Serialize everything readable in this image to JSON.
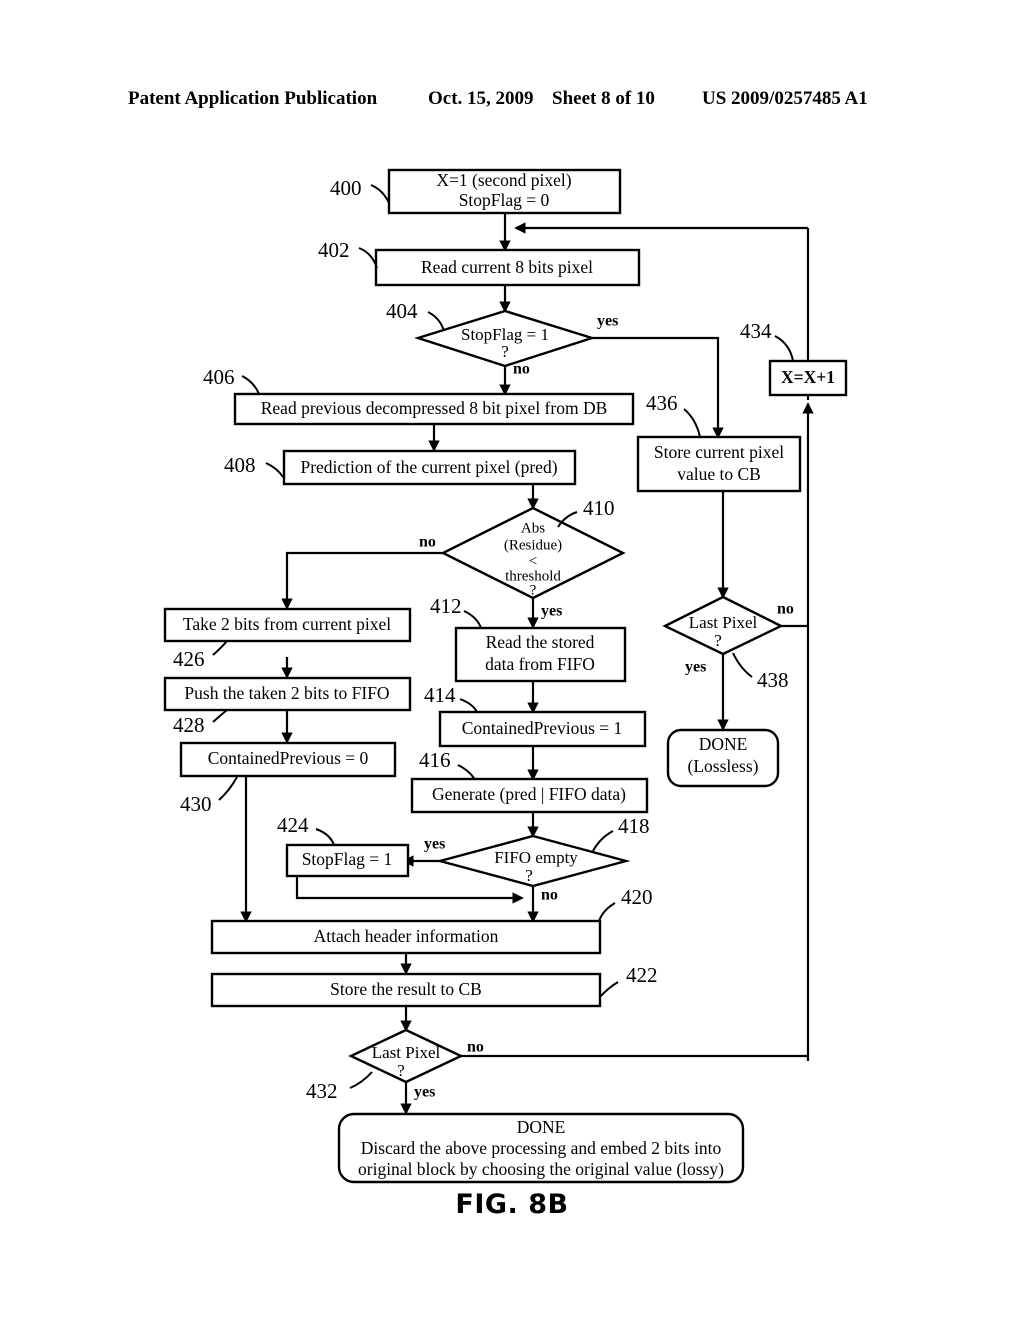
{
  "header": {
    "publication": "Patent Application Publication",
    "date": "Oct. 15, 2009",
    "sheet": "Sheet 8 of 10",
    "patent_number": "US 2009/0257485 A1"
  },
  "figure": {
    "label": "FIG. 8B",
    "caption": "FIG. 8B"
  },
  "nodes": {
    "n400": {
      "ref": "400",
      "line1": "X=1 (second pixel)",
      "line2": "StopFlag = 0"
    },
    "n402": {
      "ref": "402",
      "line1": "Read current 8 bits pixel"
    },
    "n404": {
      "ref": "404",
      "line1": "StopFlag = 1",
      "line2": "?"
    },
    "n406": {
      "ref": "406",
      "line1": "Read previous decompressed 8 bit pixel from DB"
    },
    "n408": {
      "ref": "408",
      "line1": "Prediction of the current pixel (pred)"
    },
    "n410": {
      "ref": "410",
      "line1": "Abs",
      "line2": "(Residue)",
      "line3": "<",
      "line4": "threshold",
      "line5": "?"
    },
    "n412": {
      "ref": "412",
      "line1": "Read the stored",
      "line2": "data from FIFO"
    },
    "n414": {
      "ref": "414",
      "line1": "ContainedPrevious = 1"
    },
    "n416": {
      "ref": "416",
      "line1": "Generate (pred | FIFO data)"
    },
    "n418": {
      "ref": "418",
      "line1": "FIFO empty",
      "line2": "?"
    },
    "n420": {
      "ref": "420",
      "line1": "Attach header information"
    },
    "n422": {
      "ref": "422",
      "line1": "Store the result to CB"
    },
    "n424": {
      "ref": "424",
      "line1": "StopFlag = 1"
    },
    "n426": {
      "ref": "426",
      "line1": "Take 2 bits from current pixel"
    },
    "n428": {
      "ref": "428",
      "line1": "Push the taken 2 bits to FIFO"
    },
    "n430": {
      "ref": "430",
      "line1": "ContainedPrevious = 0"
    },
    "n432": {
      "ref": "432",
      "line1": "Last Pixel",
      "line2": "?"
    },
    "n434": {
      "ref": "434",
      "line1": "X=X+1"
    },
    "n436": {
      "ref": "436",
      "line1": "Store current pixel",
      "line2": "value to CB"
    },
    "n438": {
      "ref": "438",
      "line1": "Last Pixel",
      "line2": "?"
    },
    "done_lossless": {
      "line1": "DONE",
      "line2": "(Lossless)"
    },
    "done_lossy": {
      "line1": "DONE",
      "line2": "Discard the above processing and embed 2 bits into",
      "line3": "original block by choosing  the original value (lossy)"
    }
  },
  "edge_labels": {
    "e404_yes": "yes",
    "e404_no": "no",
    "e410_no": "no",
    "e410_yes": "yes",
    "e418_yes": "yes",
    "e418_no": "no",
    "e432_no": "no",
    "e432_yes": "yes",
    "e438_no": "no",
    "e438_yes": "yes"
  },
  "colors": {
    "ink": "#000000",
    "paper": "#ffffff"
  }
}
